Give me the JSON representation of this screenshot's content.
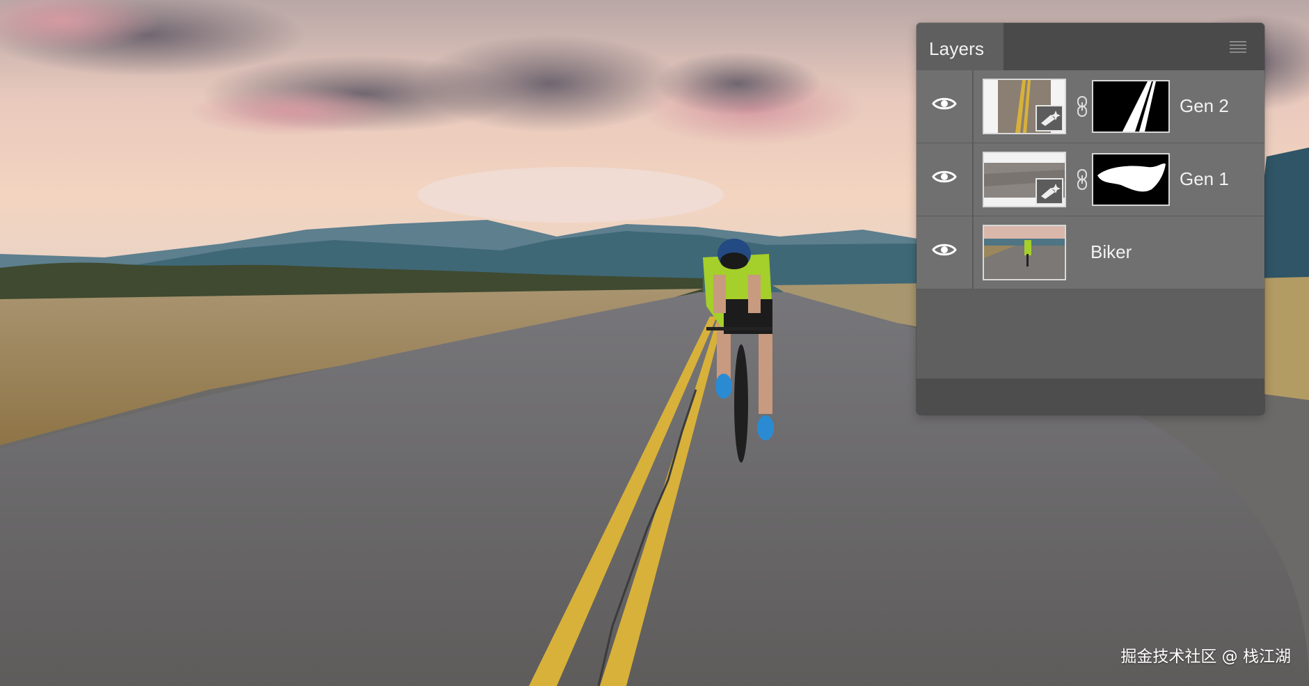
{
  "canvas": {
    "description_free": true
  },
  "layers_panel": {
    "title": "Layers",
    "menu_icon": "hamburger-menu-icon",
    "layers": [
      {
        "name": "Gen 2",
        "visible": true,
        "generative": true,
        "has_mask": true,
        "visibility_icon": "eye-icon"
      },
      {
        "name": "Gen 1",
        "visible": true,
        "generative": true,
        "has_mask": true,
        "visibility_icon": "eye-icon"
      },
      {
        "name": "Biker",
        "visible": true,
        "generative": false,
        "has_mask": false,
        "visibility_icon": "eye-icon"
      }
    ]
  },
  "watermark": {
    "text": "掘金技术社区 @ 栈江湖"
  },
  "colors": {
    "panel_bg": "#5f5f5f",
    "row_bg": "#707070",
    "header_bg": "#4a4a4a",
    "road_line": "#d8b13a"
  }
}
